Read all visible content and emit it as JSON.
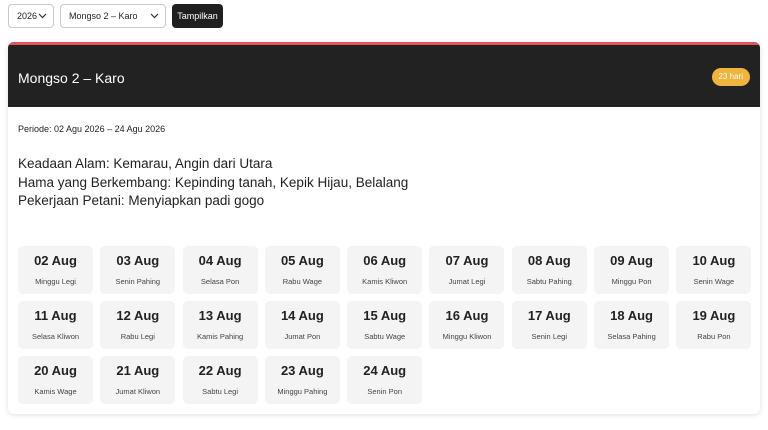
{
  "controls": {
    "year_value": "2026",
    "month_value": "Mongso 2 – Karo",
    "show_label": "Tampilkan"
  },
  "card": {
    "title": "Mongso 2 – Karo",
    "badge": "23 hari",
    "period": "Periode: 02 Agu 2026 – 24 Agu 2026",
    "info": [
      "Keadaan Alam: Kemarau, Angin dari Utara",
      "Hama yang Berkembang: Kepinding tanah, Kepik Hijau, Belalang",
      "Pekerjaan Petani: Menyiapkan padi gogo"
    ],
    "accent_color": "#e0585e",
    "badge_color": "#f0b33c"
  },
  "days": [
    {
      "date": "02 Aug",
      "pasaran": "Minggu Legi"
    },
    {
      "date": "03 Aug",
      "pasaran": "Senin Pahing"
    },
    {
      "date": "04 Aug",
      "pasaran": "Selasa Pon"
    },
    {
      "date": "05 Aug",
      "pasaran": "Rabu Wage"
    },
    {
      "date": "06 Aug",
      "pasaran": "Kamis Kliwon"
    },
    {
      "date": "07 Aug",
      "pasaran": "Jumat Legi"
    },
    {
      "date": "08 Aug",
      "pasaran": "Sabtu Pahing"
    },
    {
      "date": "09 Aug",
      "pasaran": "Minggu Pon"
    },
    {
      "date": "10 Aug",
      "pasaran": "Senin Wage"
    },
    {
      "date": "11 Aug",
      "pasaran": "Selasa Kliwon"
    },
    {
      "date": "12 Aug",
      "pasaran": "Rabu Legi"
    },
    {
      "date": "13 Aug",
      "pasaran": "Kamis Pahing"
    },
    {
      "date": "14 Aug",
      "pasaran": "Jumat Pon"
    },
    {
      "date": "15 Aug",
      "pasaran": "Sabtu Wage"
    },
    {
      "date": "16 Aug",
      "pasaran": "Minggu Kliwon"
    },
    {
      "date": "17 Aug",
      "pasaran": "Senin Legi"
    },
    {
      "date": "18 Aug",
      "pasaran": "Selasa Pahing"
    },
    {
      "date": "19 Aug",
      "pasaran": "Rabu Pon"
    },
    {
      "date": "20 Aug",
      "pasaran": "Kamis Wage"
    },
    {
      "date": "21 Aug",
      "pasaran": "Jumat Kliwon"
    },
    {
      "date": "22 Aug",
      "pasaran": "Sabtu Legi"
    },
    {
      "date": "23 Aug",
      "pasaran": "Minggu Pahing"
    },
    {
      "date": "24 Aug",
      "pasaran": "Senin Pon"
    }
  ]
}
